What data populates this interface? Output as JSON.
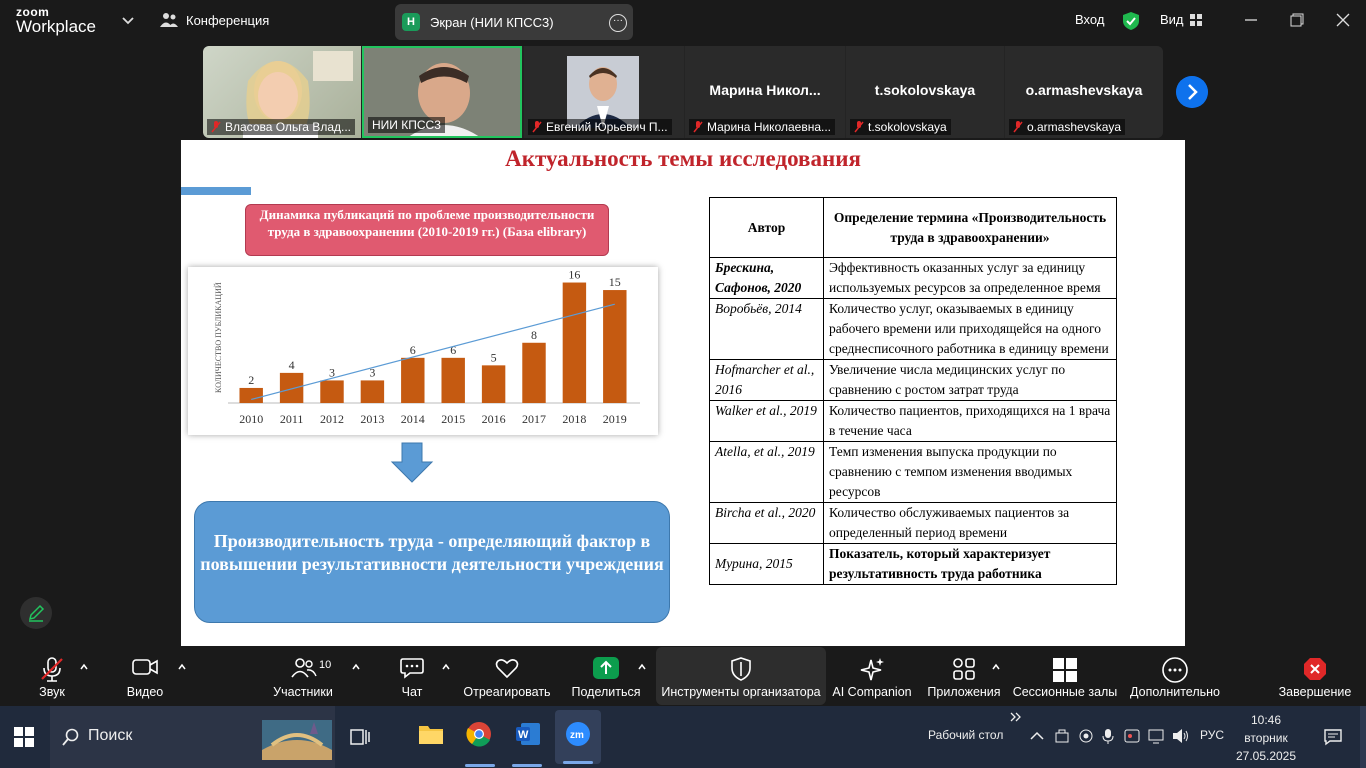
{
  "topbar": {
    "logo_line1": "zoom",
    "logo_line2": "Workplace",
    "meeting_label": "Конференция",
    "share_badge": "Н",
    "share_label": "Экран (НИИ КПСС3)",
    "login_label": "Вход",
    "view_label": "Вид"
  },
  "participants": [
    {
      "name": "Власова Ольга Влад...",
      "muted": true
    },
    {
      "name": "НИИ КПСС3",
      "muted": false,
      "active": true
    },
    {
      "name": "Евгений Юрьевич П...",
      "muted": true
    },
    {
      "name": "Марина Николаевна...",
      "big": "Марина  Никол...",
      "muted": true
    },
    {
      "name": "t.sokolovskaya",
      "big": "t.sokolovskaya",
      "muted": true
    },
    {
      "name": "o.armashevskaya",
      "big": "o.armashevskaya",
      "muted": true
    }
  ],
  "slide": {
    "title": "Актуальность темы исследования",
    "pink_box": "Динамика публикаций по проблеме производительности труда в здравоохранении (2010-2019 гг.) (База elibrary)",
    "blue_box": "Производительность труда - определяющий фактор в повышении результативности деятельности учреждения",
    "table_header_author": "Автор",
    "table_header_def": "Определение термина «Производительность труда в здравоохранении»",
    "rows": [
      {
        "author": "Брескина, Сафонов, 2020",
        "def": "Эффективность оказанных услуг за единицу используемых ресурсов за определенное время"
      },
      {
        "author": "Воробьёв, 2014",
        "def": "Количество услуг, оказываемых в единицу рабочего времени или приходящейся на одного среднесписочного работника в единицу времени"
      },
      {
        "author": "Hofmarcher et al., 2016",
        "def": "Увеличение числа медицинских услуг по сравнению с ростом затрат труда"
      },
      {
        "author": "Walker et al., 2019",
        "def": "Количество пациентов, приходящихся на 1 врача в течение часа"
      },
      {
        "author": "Atella, et al., 2019",
        "def": "Темп изменения выпуска продукции по сравнению с темпом изменения вводимых ресурсов"
      },
      {
        "author": "Bircha et al., 2020",
        "def": "Количество обслуживаемых пациентов за определенный период времени"
      },
      {
        "author": "Мурина, 2015",
        "def": "Показатель, который характеризует результативность труда работника"
      }
    ]
  },
  "chart_data": {
    "type": "bar",
    "categories": [
      "2010",
      "2011",
      "2012",
      "2013",
      "2014",
      "2015",
      "2016",
      "2017",
      "2018",
      "2019"
    ],
    "values": [
      2,
      4,
      3,
      3,
      6,
      6,
      5,
      8,
      16,
      15
    ],
    "ylabel": "КОЛИЧЕСТВО ПУБЛИКАЦИЙ",
    "bar_color": "#c55a11",
    "trendline": true,
    "ylim": [
      0,
      17
    ]
  },
  "toolbar": {
    "audio": "Звук",
    "video": "Видео",
    "participants": "Участники",
    "participants_count": "10",
    "chat": "Чат",
    "react": "Отреагировать",
    "share": "Поделиться",
    "host_tools": "Инструменты организатора",
    "ai": "AI Companion",
    "apps": "Приложения",
    "rooms": "Сессионные залы",
    "more": "Дополнительно",
    "end": "Завершение"
  },
  "taskbar": {
    "search": "Поиск",
    "desktop": "Рабочий стол",
    "lang": "РУС",
    "time": "10:46",
    "day": "вторник",
    "date": "27.05.2025"
  },
  "colors": {
    "accent": "#0e72ed",
    "share_green": "#0c9d4d",
    "end_red": "#e02828",
    "shield_green": "#1fb84e"
  }
}
